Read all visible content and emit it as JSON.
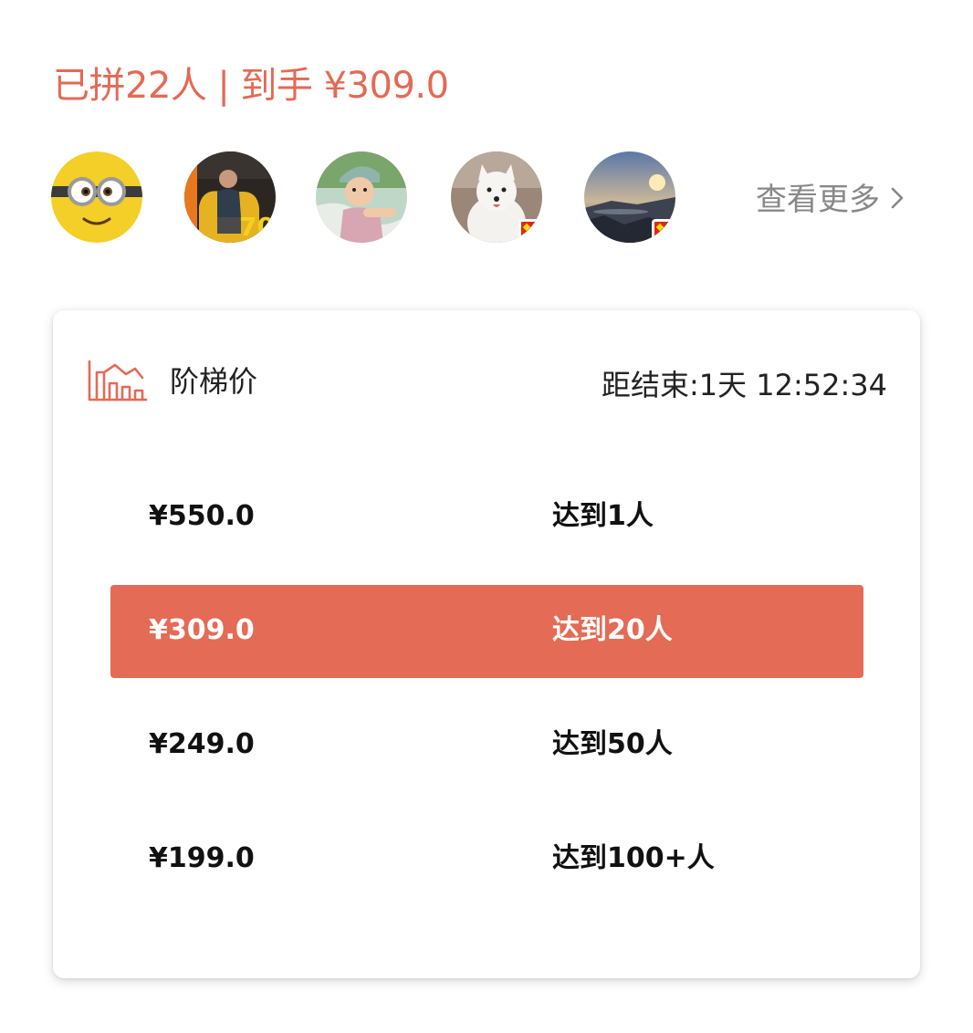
{
  "summary": {
    "joined": "已拼22人",
    "separator": "|",
    "final_price": "到手 ¥309.0"
  },
  "participants": {
    "avatars": [
      {
        "icon": "minion-avatar",
        "flag": false
      },
      {
        "icon": "person-on-yellow-chair-avatar",
        "flag": false
      },
      {
        "icon": "child-avatar",
        "flag": false
      },
      {
        "icon": "white-dog-avatar",
        "flag": true
      },
      {
        "icon": "coast-sunset-avatar",
        "flag": true
      }
    ],
    "more_label": "查看更多",
    "more_icon": "chevron-right-icon"
  },
  "tier_card": {
    "icon": "tier-chart-icon",
    "title": "阶梯价",
    "countdown": "距结束:1天 12:52:34",
    "tiers": [
      {
        "price": "¥550.0",
        "condition": "达到1人",
        "active": false
      },
      {
        "price": "¥309.0",
        "condition": "达到20人",
        "active": true
      },
      {
        "price": "¥249.0",
        "condition": "达到50人",
        "active": false
      },
      {
        "price": "¥199.0",
        "condition": "达到100+人",
        "active": false
      }
    ]
  },
  "colors": {
    "accent": "#e46b55",
    "text_primary": "#111111",
    "text_secondary": "#888888",
    "card_bg": "#ffffff"
  }
}
